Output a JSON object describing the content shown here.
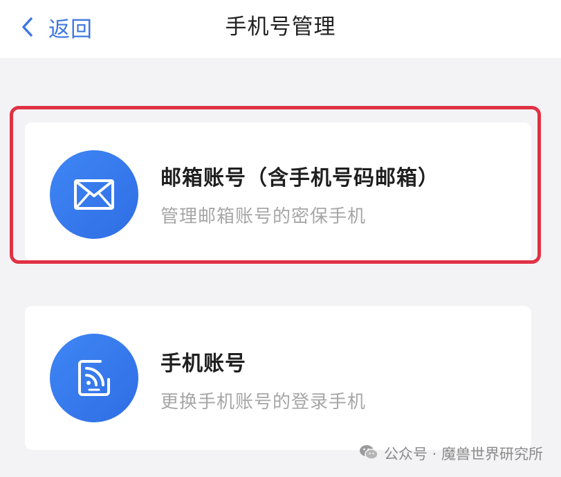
{
  "header": {
    "back_label": "返回",
    "title": "手机号管理"
  },
  "options": [
    {
      "icon": "envelope-icon",
      "title": "邮箱账号（含手机号码邮箱）",
      "subtitle": "管理邮箱账号的密保手机",
      "highlighted": true
    },
    {
      "icon": "phone-signal-icon",
      "title": "手机账号",
      "subtitle": "更换手机账号的登录手机",
      "highlighted": false
    }
  ],
  "watermark": {
    "icon": "wechat-icon",
    "text": "公众号 · 魔兽世界研究所"
  },
  "colors": {
    "accent": "#3f78e0",
    "icon_bg": "#3a7ef0",
    "highlight": "#e03143",
    "page_bg": "#f3f3f5"
  }
}
